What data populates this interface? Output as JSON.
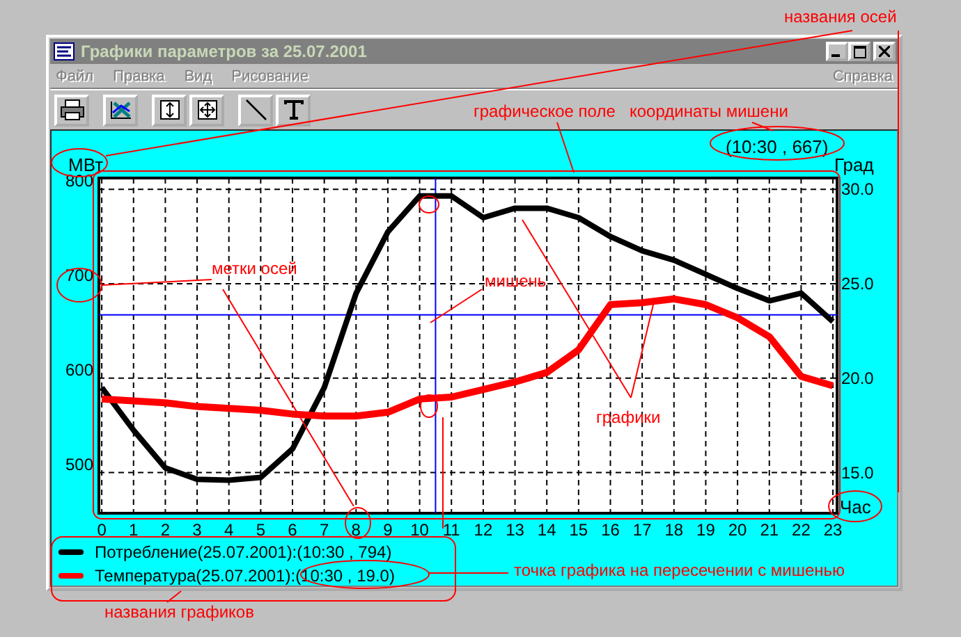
{
  "window": {
    "title": "Графики параметров за 25.07.2001",
    "active": false
  },
  "menu": {
    "items": [
      {
        "label": "Файл",
        "disabled": true
      },
      {
        "label": "Правка",
        "disabled": true
      },
      {
        "label": "Вид",
        "disabled": true
      },
      {
        "label": "Рисование",
        "disabled": true
      }
    ],
    "help_item": {
      "label": "Справка",
      "disabled": true
    }
  },
  "chart": {
    "target_coords": "(10:30 , 667)",
    "chart_data": {
      "type": "line",
      "xlabel": "Час",
      "ylabel": "МВт",
      "y2label": "Град",
      "x": [
        0,
        1,
        2,
        3,
        4,
        5,
        6,
        7,
        8,
        9,
        10,
        11,
        12,
        13,
        14,
        15,
        16,
        17,
        18,
        19,
        20,
        21,
        22,
        23
      ],
      "xlim": [
        -0.09,
        23.13
      ],
      "ylim": [
        457,
        812
      ],
      "y2lim": [
        12.85,
        30.6
      ],
      "xticks": [
        0,
        1,
        2,
        3,
        4,
        5,
        6,
        7,
        8,
        9,
        10,
        11,
        12,
        13,
        14,
        15,
        16,
        17,
        18,
        19,
        20,
        21,
        22,
        23
      ],
      "yticks": [
        500,
        600,
        700,
        800
      ],
      "grid": true,
      "ref_lines": [
        {
          "axis": "x",
          "value": 10.5,
          "color": "#0000ff"
        },
        {
          "axis": "y",
          "value": 667,
          "color": "#0000ff"
        }
      ],
      "y2ticks": [
        {
          "value": 15,
          "label": "15.0"
        },
        {
          "value": 20,
          "label": "20.0"
        },
        {
          "value": 25,
          "label": "25.0"
        },
        {
          "value": 30,
          "label": "30.0"
        }
      ],
      "series": [
        {
          "name": "Потребление",
          "color": "#000000",
          "values": [
            590,
            545,
            505,
            493,
            492,
            495,
            525,
            590,
            690,
            755,
            793,
            793,
            770,
            780,
            780,
            770,
            750,
            735,
            725,
            710,
            695,
            682,
            690,
            660
          ]
        },
        {
          "name": "Температура",
          "color": "#ff0000",
          "axis": "y2",
          "values": [
            18.9,
            18.8,
            18.7,
            18.5,
            18.4,
            18.3,
            18.1,
            18.0,
            18.0,
            18.2,
            18.9,
            19.0,
            19.4,
            19.8,
            20.3,
            21.5,
            23.9,
            24.0,
            24.2,
            23.9,
            23.2,
            22.2,
            20.1,
            19.6
          ]
        }
      ]
    }
  },
  "legend": [
    {
      "text": "(25.07.2001):(10:30 , 794)"
    },
    {
      "text": "(25.07.2001):(10:30 , 19.0)"
    }
  ],
  "annotations": [
    {
      "text": "названия осей"
    },
    {
      "text": "графическое поле"
    },
    {
      "text": "координаты мишени"
    },
    {
      "text": "метки осей"
    },
    {
      "text": "мишень"
    },
    {
      "text": "графики"
    },
    {
      "text": "точка графика на пересечении с мишенью"
    },
    {
      "text": "названия графиков"
    }
  ]
}
